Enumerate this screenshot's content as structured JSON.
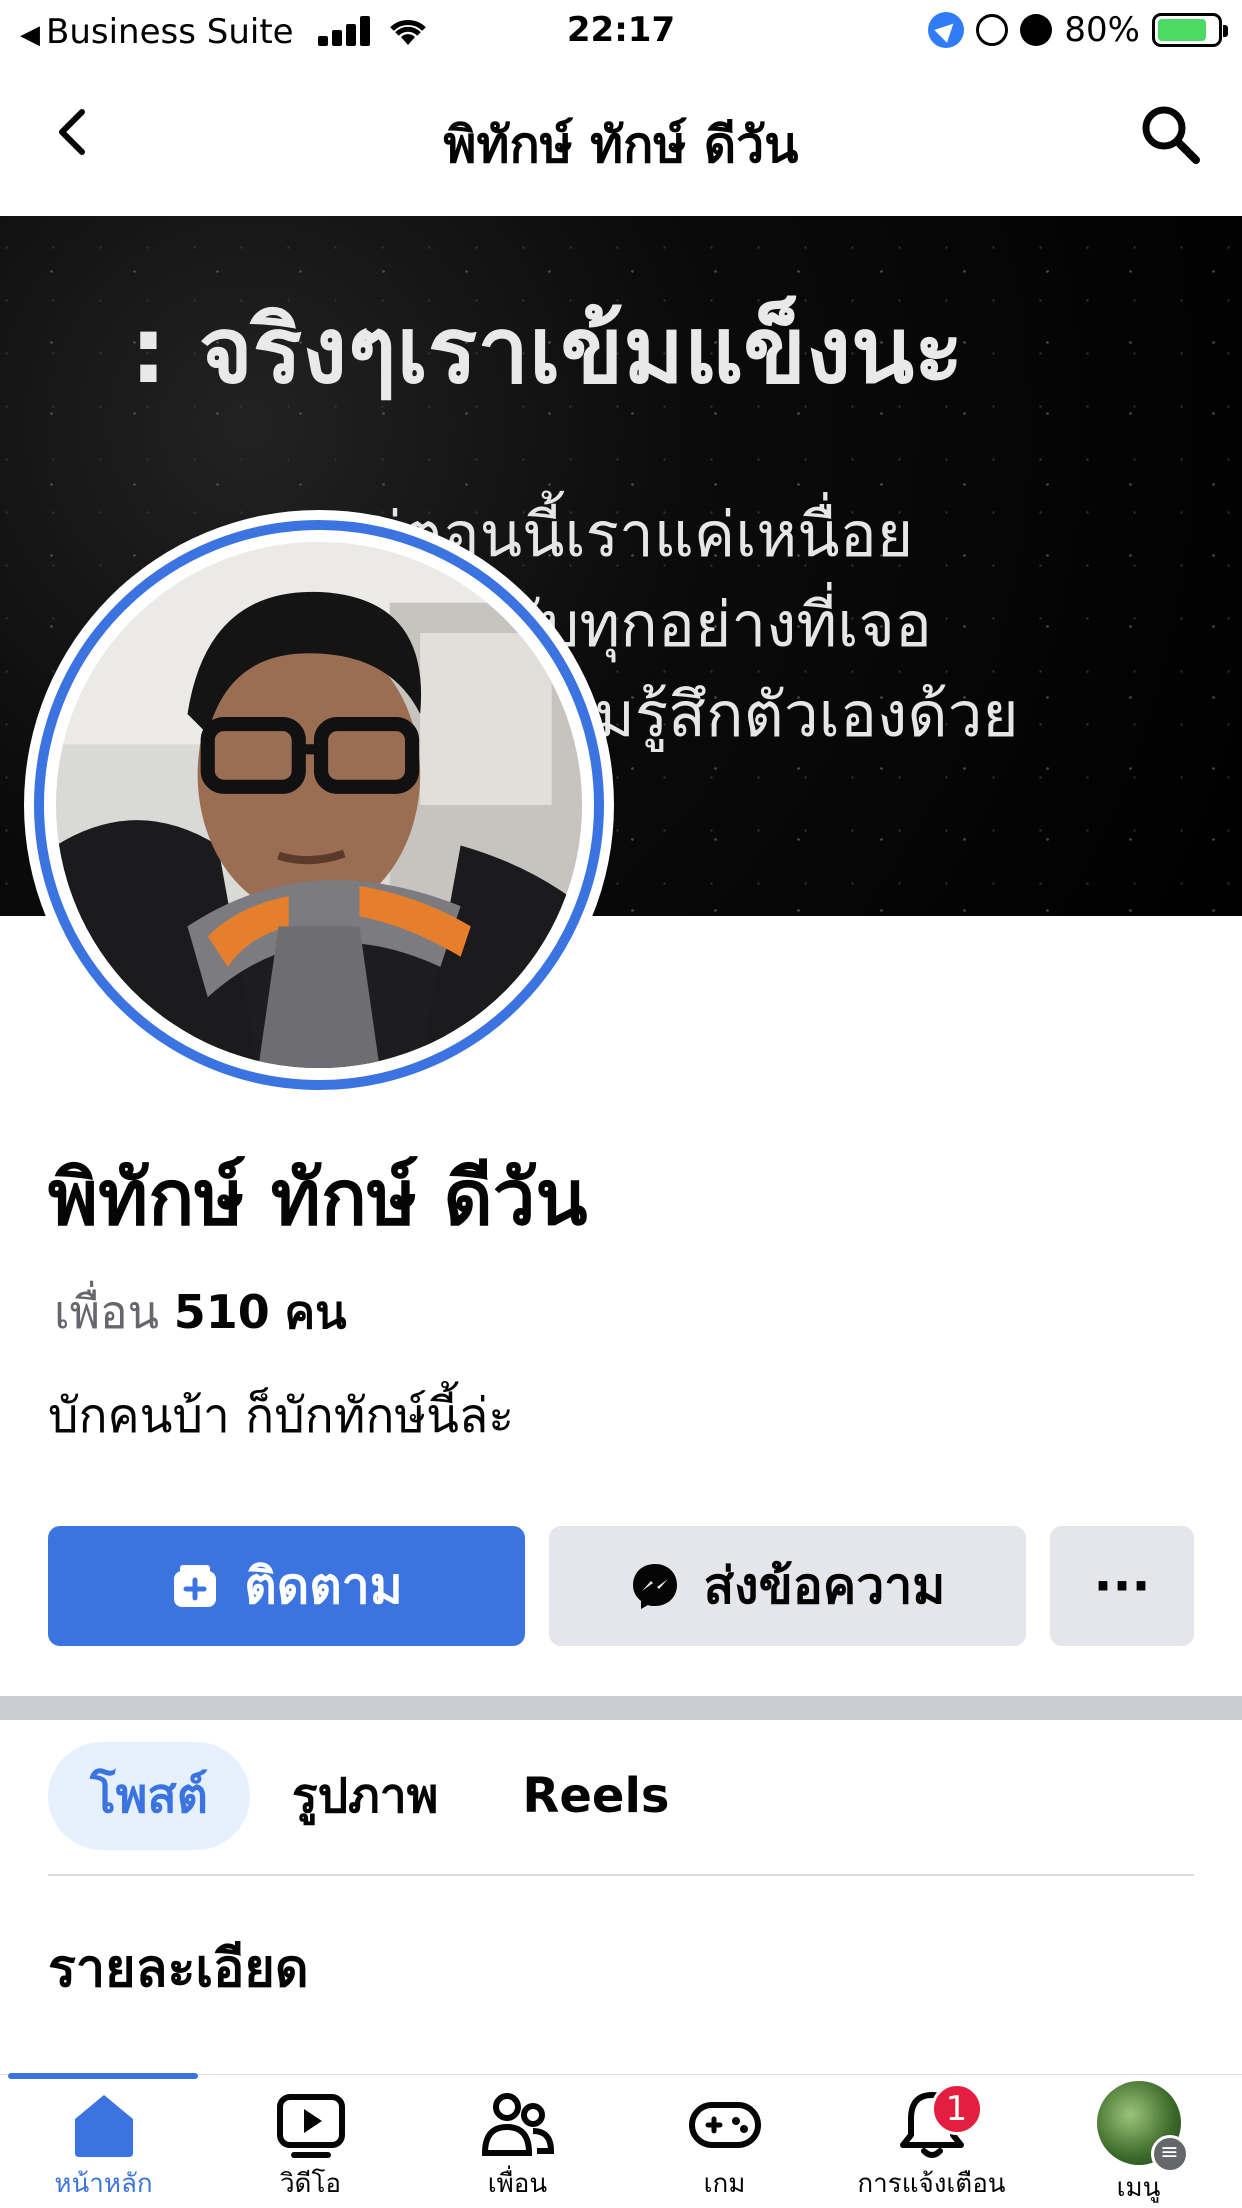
{
  "status_bar": {
    "back_app": "Business Suite",
    "time": "22:17",
    "battery": "80%"
  },
  "header": {
    "title": "พิทักษ์ ทักษ์ ดีวัน",
    "back_icon": "chevron-left-icon",
    "search_icon": "search-icon"
  },
  "cover": {
    "line1": ": จริงๆเราเข้มแข็งนะ",
    "line2": "แต่ตอนนี้เราแค่เหนื่อย",
    "line3": "ับทุกอย่างที่เจอ",
    "line4": "มรู้สึกตัวเองด้วย"
  },
  "profile": {
    "name": "พิทักษ์ ทักษ์ ดีวัน",
    "friends_label": "เพื่อน",
    "friends_count": "510",
    "friends_unit": "คน",
    "bio": "บักคนบ้า ก็บักทักษ์นี้ล่ะ"
  },
  "actions": {
    "follow": "ติดตาม",
    "message": "ส่งข้อความ",
    "more": "···",
    "follow_color": "#3b74e0"
  },
  "tabs": [
    {
      "label": "โพสต์",
      "active": true
    },
    {
      "label": "รูปภาพ",
      "active": false
    },
    {
      "label": "Reels",
      "active": false
    }
  ],
  "details": {
    "title": "รายละเอียด"
  },
  "tabbar": {
    "items": [
      {
        "label": "หน้าหลัก",
        "icon": "home-icon"
      },
      {
        "label": "วิดีโอ",
        "icon": "video-icon"
      },
      {
        "label": "เพื่อน",
        "icon": "friends-icon"
      },
      {
        "label": "เกม",
        "icon": "gaming-icon"
      },
      {
        "label": "การแจ้งเตือน",
        "icon": "bell-icon",
        "badge": "1"
      },
      {
        "label": "เมนู",
        "icon": "menu-avatar-icon"
      }
    ]
  }
}
